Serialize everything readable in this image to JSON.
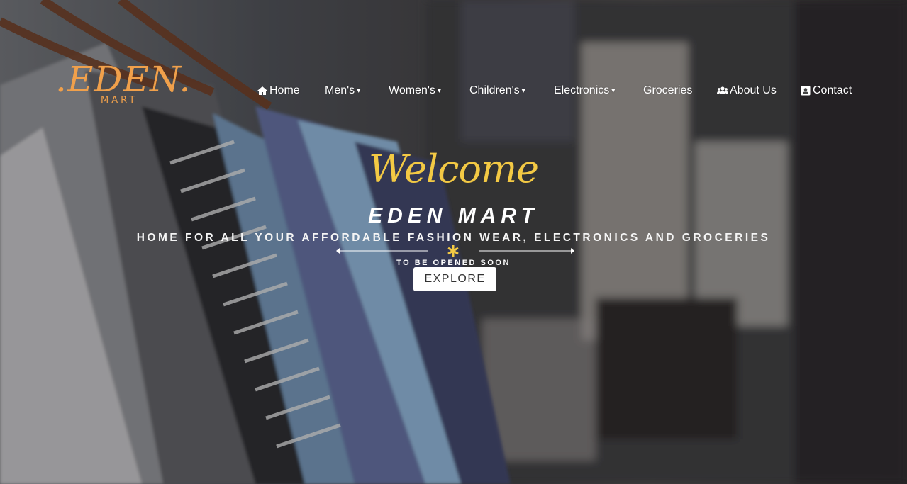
{
  "logo": {
    "main": ".EDEN.",
    "sub": "MART"
  },
  "nav": {
    "home": {
      "label": "Home",
      "icon": "home-icon"
    },
    "men": {
      "label": "Men's"
    },
    "women": {
      "label": "Women's"
    },
    "children": {
      "label": "Children's"
    },
    "electronics": {
      "label": "Electronics"
    },
    "groceries": {
      "label": "Groceries"
    },
    "about": {
      "label": "About Us",
      "icon": "users-icon"
    },
    "contact": {
      "label": "Contact",
      "icon": "contact-card-icon"
    },
    "caret": "▾"
  },
  "hero": {
    "welcome": "Welcome",
    "brand": "EDEN MART",
    "tagline": "HOME FOR ALL YOUR AFFORDABLE FASHION WEAR, ELECTRONICS AND GROCERIES",
    "divider_icon": "asterisk-icon",
    "soon": "TO BE OPENED SOON",
    "button": "EXPLORE"
  },
  "colors": {
    "logo": "#f0a04b",
    "welcome": "#f3c944",
    "accent_star": "#f3c944",
    "text": "#ffffff",
    "button_bg": "#ffffff"
  }
}
